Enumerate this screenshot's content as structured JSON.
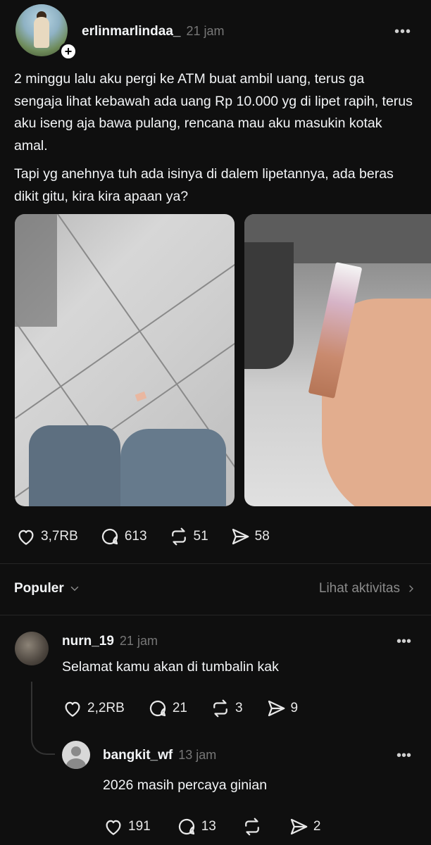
{
  "post": {
    "username": "erlinmarlindaa_",
    "time": "21 jam",
    "more_icon": "more-horizontal-icon",
    "paragraph1": "2 minggu lalu aku pergi ke ATM buat ambil uang, terus ga sengaja lihat kebawah ada uang Rp 10.000 yg di lipet rapih, terus aku iseng aja bawa pulang, rencana mau aku masukin kotak amal.",
    "paragraph2": "Tapi yg anehnya tuh ada isinya di dalem lipetannya, ada beras dikit gitu, kira kira apaan ya?",
    "actions": {
      "likes": "3,7RB",
      "comments": "613",
      "reposts": "51",
      "shares": "58"
    }
  },
  "sort": {
    "label": "Populer",
    "activity_link": "Lihat aktivitas"
  },
  "reply": {
    "username": "nurn_19",
    "time": "21 jam",
    "text": "Selamat kamu akan di tumbalin kak",
    "actions": {
      "likes": "2,2RB",
      "comments": "21",
      "reposts": "3",
      "shares": "9"
    }
  },
  "nested_reply": {
    "username": "bangkit_wf",
    "time": "13 jam",
    "text": "2026 masih percaya ginian",
    "actions": {
      "likes": "191",
      "comments": "13",
      "shares": "2"
    }
  },
  "colors": {
    "background": "#0f0f0f",
    "text": "#f3f5f7",
    "muted": "#777777"
  }
}
